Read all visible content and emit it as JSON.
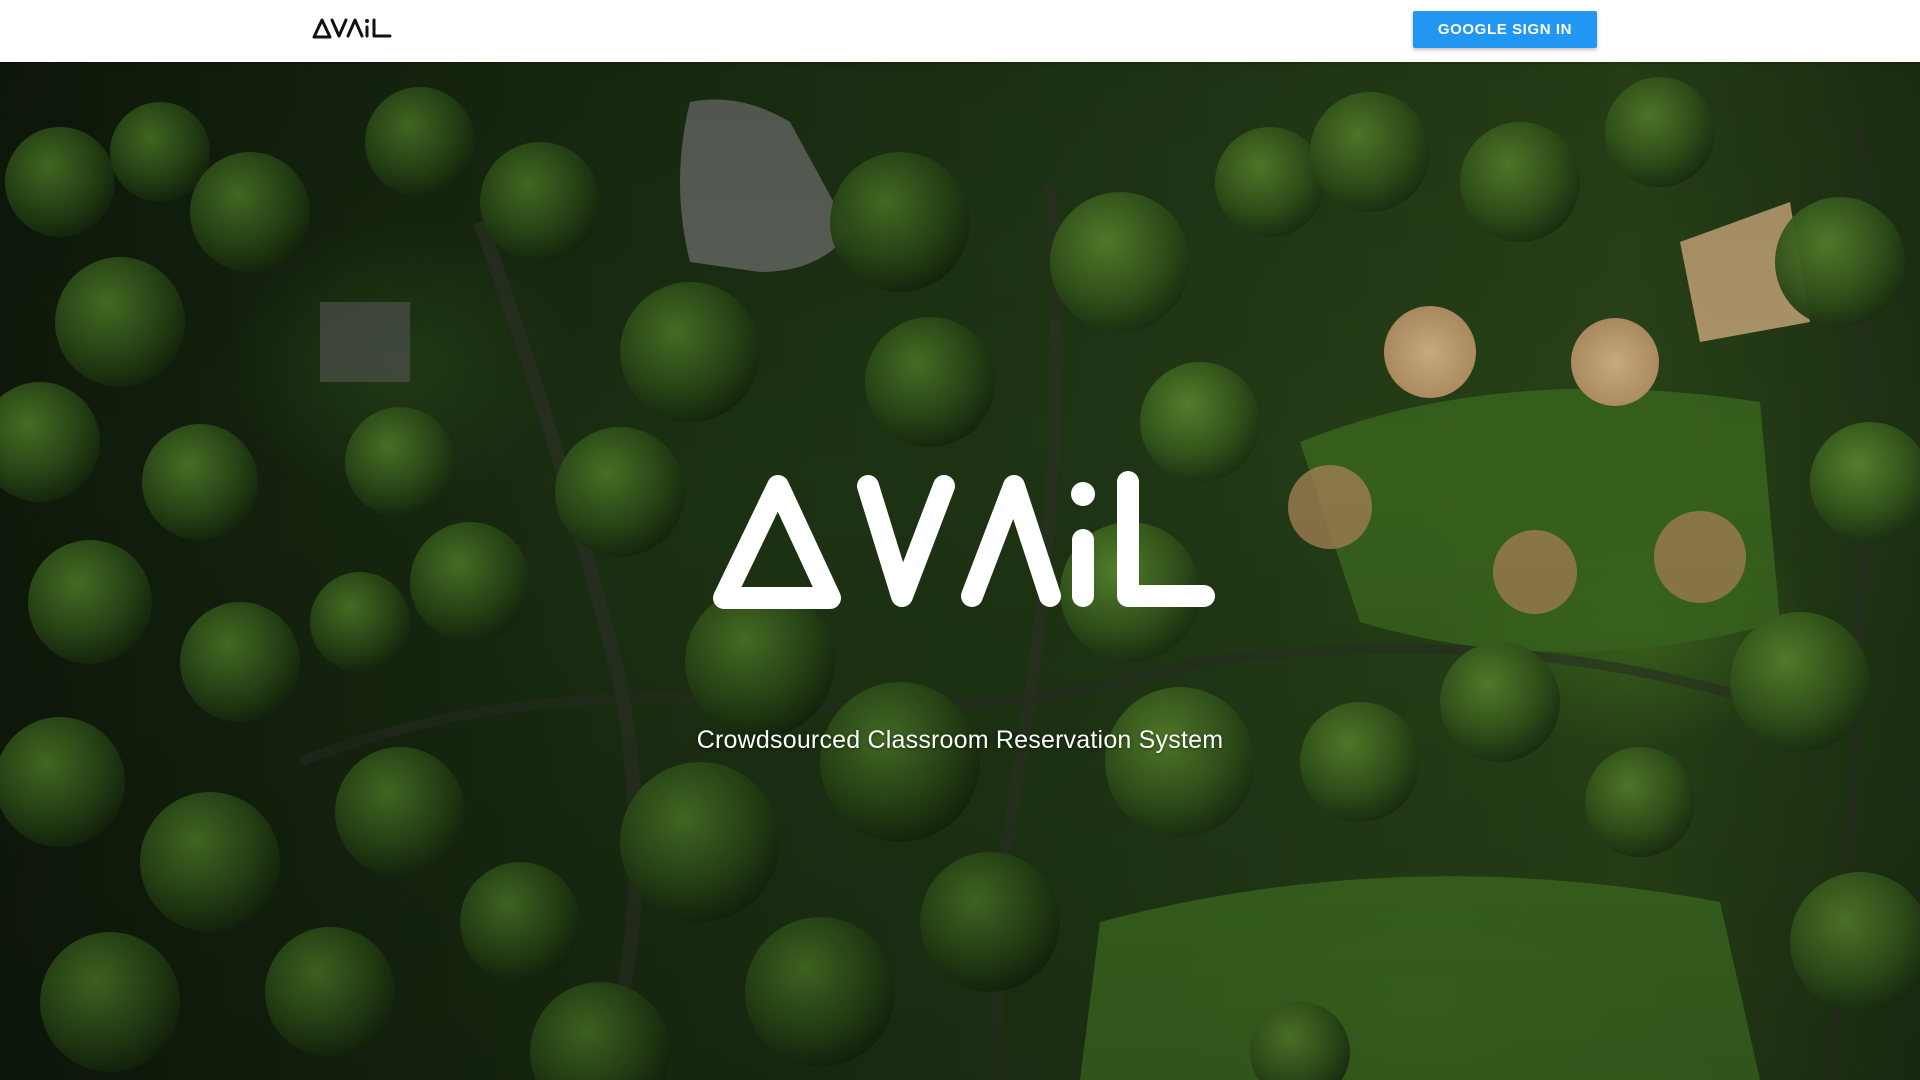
{
  "navbar": {
    "logo_text": "AVAiL",
    "signin_label": "GOOGLE SIGN IN"
  },
  "hero": {
    "logo_text": "AVAiL",
    "tagline": "Crowdsourced Classroom Reservation System",
    "background": "aerial photo of park with trees and ball fields"
  },
  "colors": {
    "navbar_bg": "#ffffff",
    "button_bg": "#2196f3",
    "button_text": "#ffffff",
    "logo_dark": "#111111",
    "logo_light": "#ffffff"
  }
}
